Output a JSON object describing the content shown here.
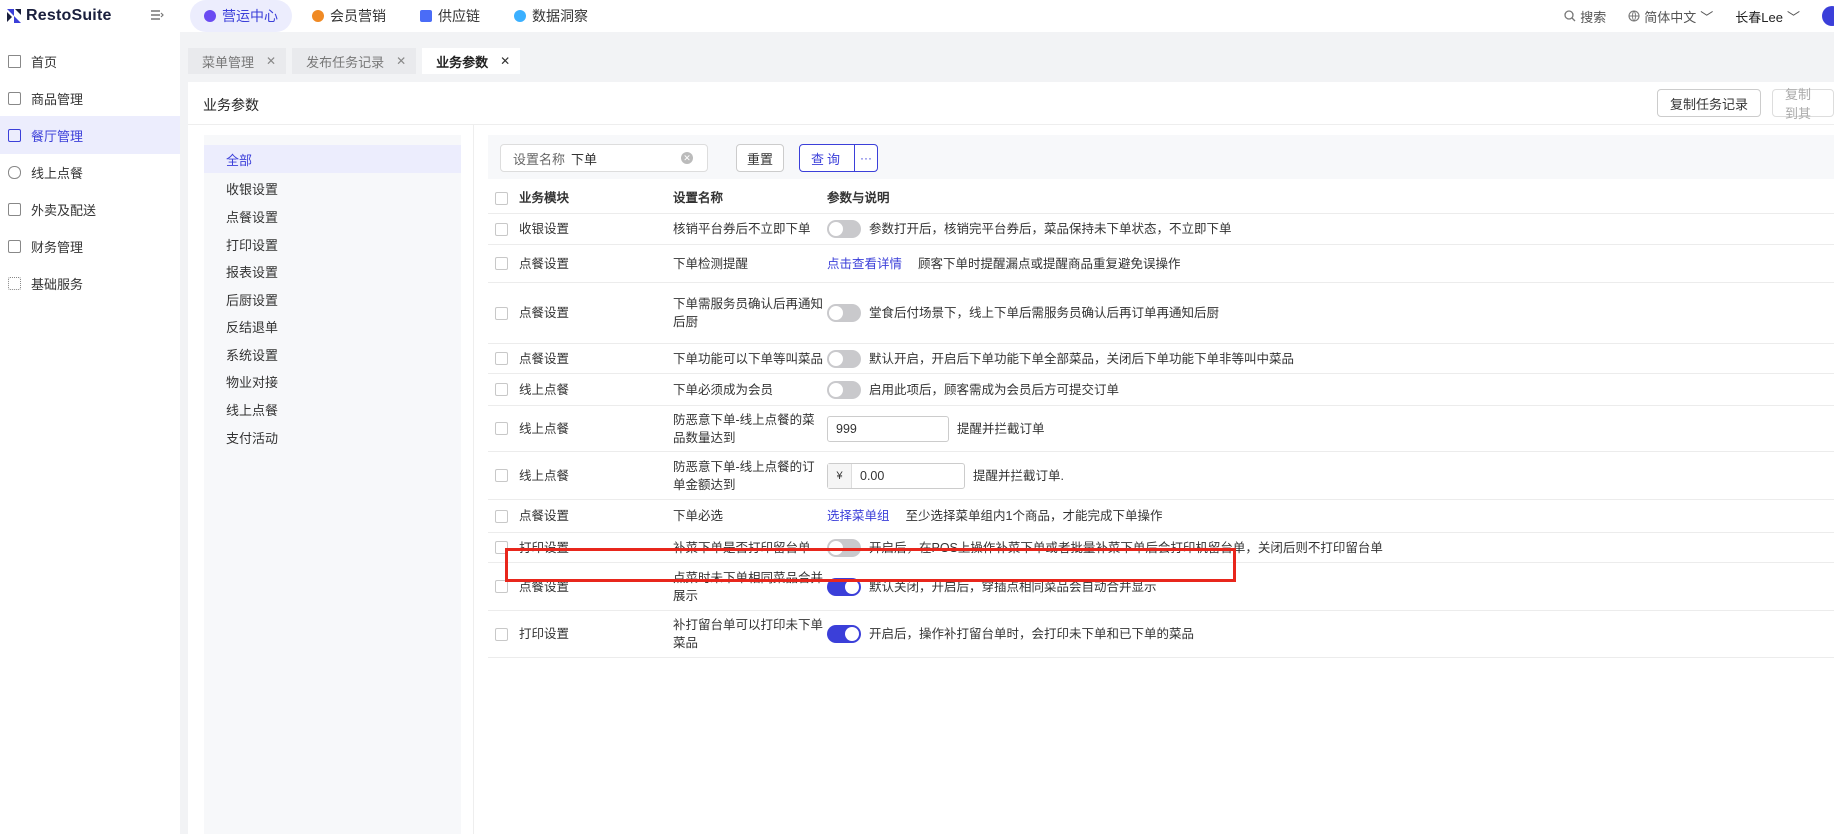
{
  "app": {
    "logo_text": "RestoSuite"
  },
  "topnav": [
    {
      "label": "营运中心",
      "color": "#6a4bf2",
      "active": true
    },
    {
      "label": "会员营销",
      "color": "#f08a24",
      "active": false
    },
    {
      "label": "供应链",
      "color": "#4a6cf7",
      "active": false
    },
    {
      "label": "数据洞察",
      "color": "#3bb0ff",
      "active": false
    }
  ],
  "top_right": {
    "search": "搜索",
    "language": "简体中文",
    "user": "长春Lee"
  },
  "sidebar": {
    "items": [
      {
        "label": "首页",
        "icon": "home-icon",
        "active": false
      },
      {
        "label": "商品管理",
        "icon": "box-icon",
        "active": false
      },
      {
        "label": "餐厅管理",
        "icon": "store-icon",
        "active": true
      },
      {
        "label": "线上点餐",
        "icon": "hand-icon",
        "active": false
      },
      {
        "label": "外卖及配送",
        "icon": "bag-icon",
        "active": false
      },
      {
        "label": "财务管理",
        "icon": "wallet-icon",
        "active": false
      },
      {
        "label": "基础服务",
        "icon": "grid-icon",
        "active": false
      }
    ]
  },
  "tabs": [
    {
      "label": "菜单管理",
      "active": false
    },
    {
      "label": "发布任务记录",
      "active": false
    },
    {
      "label": "业务参数",
      "active": true
    }
  ],
  "main": {
    "title": "业务参数",
    "copy_records_button": "复制任务记录",
    "copy_to_button": "复制到其"
  },
  "categories": [
    "全部",
    "收银设置",
    "点餐设置",
    "打印设置",
    "报表设置",
    "后厨设置",
    "反结退单",
    "系统设置",
    "物业对接",
    "线上点餐",
    "支付活动"
  ],
  "filter": {
    "label": "设置名称",
    "value": "下单",
    "reset": "重置",
    "query": "查询",
    "more": "···"
  },
  "table": {
    "headers": {
      "module": "业务模块",
      "name": "设置名称",
      "param": "参数与说明"
    },
    "rows": [
      {
        "module": "收银设置",
        "name": "核销平台券后不立即下单",
        "type": "toggle",
        "on": false,
        "desc": "参数打开后，核销完平台券后，菜品保持未下单状态，不立即下单"
      },
      {
        "module": "点餐设置",
        "name": "下单检测提醒",
        "type": "link",
        "link": "点击查看详情",
        "desc": "顾客下单时提醒漏点或提醒商品重复避免误操作"
      },
      {
        "module": "点餐设置",
        "name": "下单需服务员确认后再通知后厨",
        "type": "toggle",
        "on": false,
        "desc": "堂食后付场景下，线上下单后需服务员确认后再订单再通知后厨"
      },
      {
        "module": "点餐设置",
        "name": "下单功能可以下单等叫菜品",
        "type": "toggle",
        "on": false,
        "desc": "默认开启，开启后下单功能下单全部菜品，关闭后下单功能下单非等叫中菜品"
      },
      {
        "module": "线上点餐",
        "name": "下单必须成为会员",
        "type": "toggle",
        "on": false,
        "desc": "启用此项后，顾客需成为会员后方可提交订单"
      },
      {
        "module": "线上点餐",
        "name": "防恶意下单-线上点餐的菜品数量达到",
        "type": "number",
        "value": "999",
        "desc": "提醒并拦截订单"
      },
      {
        "module": "线上点餐",
        "name": "防恶意下单-线上点餐的订单金额达到",
        "type": "money",
        "prefix": "¥",
        "value": "0.00",
        "desc": "提醒并拦截订单."
      },
      {
        "module": "点餐设置",
        "name": "下单必选",
        "type": "link",
        "link": "选择菜单组",
        "desc": "至少选择菜单组内1个商品，才能完成下单操作"
      },
      {
        "module": "打印设置",
        "name": "补菜下单是否打印留台单",
        "type": "toggle",
        "on": false,
        "desc": "开启后，在POS上操作补菜下单或者批量补菜下单后会打印机留台单，关闭后则不打印留台单"
      },
      {
        "module": "点餐设置",
        "name": "点菜时未下单相同菜品合并展示",
        "type": "toggle",
        "on": true,
        "desc": "默认关闭，开启后，穿插点相同菜品会自动合并显示"
      },
      {
        "module": "打印设置",
        "name": "补打留台单可以打印未下单菜品",
        "type": "toggle",
        "on": true,
        "desc": "开启后，操作补打留台单时，会打印未下单和已下单的菜品"
      }
    ]
  },
  "colors": {
    "accent": "#3b3fd9",
    "highlight": "#e8261c"
  }
}
